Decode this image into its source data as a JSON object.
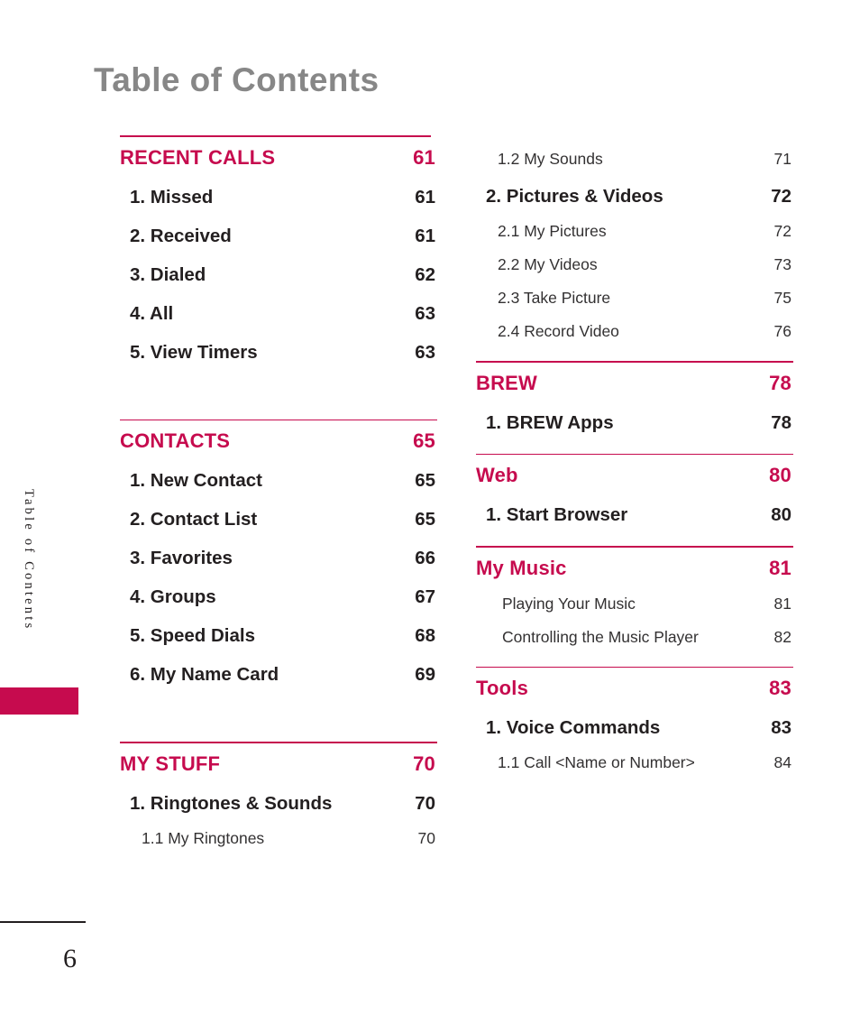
{
  "page": {
    "title": "Table of Contents",
    "side_tab_label": "Table of Contents",
    "page_number": "6",
    "accent_color": "#c60b4e",
    "title_color": "#878787",
    "text_color": "#231f20"
  },
  "columns": {
    "left": [
      {
        "heading": {
          "label": "RECENT CALLS",
          "page": "61"
        },
        "entries": [
          {
            "level": 1,
            "label": "1. Missed",
            "page": "61"
          },
          {
            "level": 1,
            "label": "2. Received",
            "page": "61"
          },
          {
            "level": 1,
            "label": "3. Dialed",
            "page": "62"
          },
          {
            "level": 1,
            "label": "4. All",
            "page": "63"
          },
          {
            "level": 1,
            "label": "5. View Timers",
            "page": "63"
          }
        ]
      },
      {
        "heading": {
          "label": "CONTACTS",
          "page": "65"
        },
        "entries": [
          {
            "level": 1,
            "label": "1. New Contact",
            "page": "65"
          },
          {
            "level": 1,
            "label": "2. Contact List",
            "page": "65"
          },
          {
            "level": 1,
            "label": "3. Favorites",
            "page": "66"
          },
          {
            "level": 1,
            "label": "4. Groups",
            "page": "67"
          },
          {
            "level": 1,
            "label": "5. Speed Dials",
            "page": "68"
          },
          {
            "level": 1,
            "label": "6. My Name Card",
            "page": "69"
          }
        ]
      },
      {
        "heading": {
          "label": "MY STUFF",
          "page": "70"
        },
        "entries": [
          {
            "level": 1,
            "label": "1. Ringtones & Sounds",
            "page": "70"
          },
          {
            "level": 2,
            "label": "1.1 My Ringtones",
            "page": "70"
          }
        ]
      }
    ],
    "right": [
      {
        "heading": null,
        "entries": [
          {
            "level": 2,
            "label": "1.2 My Sounds",
            "page": "71"
          },
          {
            "level": 1,
            "label": "2. Pictures & Videos",
            "page": "72"
          },
          {
            "level": 2,
            "label": "2.1 My Pictures",
            "page": "72"
          },
          {
            "level": 2,
            "label": "2.2 My Videos",
            "page": "73"
          },
          {
            "level": 2,
            "label": "2.3 Take Picture",
            "page": "75"
          },
          {
            "level": 2,
            "label": "2.4 Record Video",
            "page": "76"
          }
        ]
      },
      {
        "heading": {
          "label": "BREW",
          "page": "78"
        },
        "entries": [
          {
            "level": 1,
            "label": "1. BREW Apps",
            "page": "78"
          }
        ]
      },
      {
        "heading": {
          "label": "Web",
          "page": "80"
        },
        "entries": [
          {
            "level": 1,
            "label": "1. Start Browser",
            "page": "80"
          }
        ]
      },
      {
        "heading": {
          "label": "My Music",
          "page": "81"
        },
        "entries": [
          {
            "level": 0,
            "label": "Playing Your Music",
            "page": "81"
          },
          {
            "level": 0,
            "label": "Controlling the Music Player",
            "page": "82"
          }
        ]
      },
      {
        "heading": {
          "label": "Tools",
          "page": "83"
        },
        "entries": [
          {
            "level": 1,
            "label": "1. Voice Commands",
            "page": "83"
          },
          {
            "level": 2,
            "label": "1.1 Call <Name or Number>",
            "page": "84"
          }
        ]
      }
    ]
  }
}
